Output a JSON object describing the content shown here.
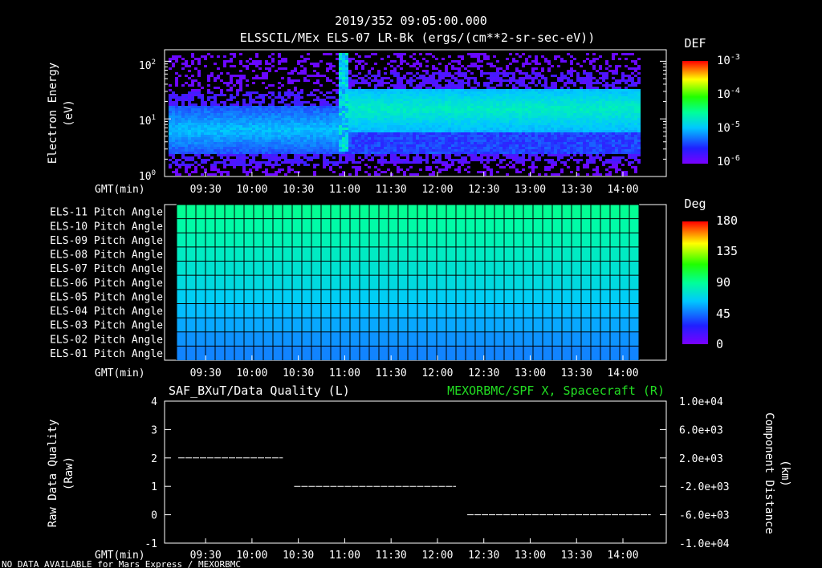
{
  "header": {
    "timestamp": "2019/352 09:05:00.000",
    "title": "ELSSCIL/MEx ELS-07 LR-Bk  (ergs/(cm**2-sr-sec-eV))"
  },
  "time_axis": {
    "label": "GMT(min)",
    "ticks": [
      "09:30",
      "10:00",
      "10:30",
      "11:00",
      "11:30",
      "12:00",
      "12:30",
      "13:00",
      "13:30",
      "14:00"
    ]
  },
  "footer": {
    "note": "NO DATA AVAILABLE for Mars Express / MEXORBMC"
  },
  "colors": {
    "background": "#000000",
    "foreground": "#ffffff",
    "right_axis_title": "#22dd22"
  },
  "chart_data": [
    {
      "type": "heatmap",
      "title": "ELSSCIL/MEx ELS-07 LR-Bk  (ergs/(cm**2-sr-sec-eV))",
      "ylabel": "Electron Energy (eV)",
      "y_scale": "log",
      "y_ticks": [
        "10^0",
        "10^1",
        "10^2"
      ],
      "colorbar": {
        "title": "DEF",
        "scale": "log",
        "ticks": [
          "10^-3",
          "10^-4",
          "10^-5",
          "10^-6"
        ]
      },
      "description_values": {
        "before_1055": "low flux ~10^-6 to 10^-5 concentrated 3-15 eV",
        "after_1055": "enhanced flux ~10^-5 to 10^-4 at 5-30 eV, burst up to ~150 eV near 10:55"
      }
    },
    {
      "type": "heatmap",
      "colorbar": {
        "title": "Deg",
        "ticks": [
          "180",
          "135",
          "90",
          "45",
          "0"
        ]
      },
      "rows": [
        {
          "name": "ELS-11 Pitch Angle",
          "value": 110
        },
        {
          "name": "ELS-10 Pitch Angle",
          "value": 106
        },
        {
          "name": "ELS-09 Pitch Angle",
          "value": 102
        },
        {
          "name": "ELS-08 Pitch Angle",
          "value": 98
        },
        {
          "name": "ELS-07 Pitch Angle",
          "value": 94
        },
        {
          "name": "ELS-06 Pitch Angle",
          "value": 90
        },
        {
          "name": "ELS-05 Pitch Angle",
          "value": 84
        },
        {
          "name": "ELS-04 Pitch Angle",
          "value": 78
        },
        {
          "name": "ELS-03 Pitch Angle",
          "value": 72
        },
        {
          "name": "ELS-02 Pitch Angle",
          "value": 66
        },
        {
          "name": "ELS-01 Pitch Angle",
          "value": 62
        }
      ]
    },
    {
      "type": "line",
      "title_left": "SAF_BXuT/Data Quality (L)",
      "title_right": "MEXORBMC/SPF X, Spacecraft (R)",
      "ylabel": "Raw Data Quality (Raw)",
      "ylabel_right": "Component Distance (km)",
      "ylim": [
        -1,
        4
      ],
      "y_ticks": [
        "4",
        "3",
        "2",
        "1",
        "0",
        "-1"
      ],
      "y_right_ticks": [
        "1.0e+04",
        "6.0e+03",
        "2.0e+03",
        "-2.0e+03",
        "-6.0e+03",
        "-1.0e+04"
      ],
      "series": [
        {
          "segments": [
            {
              "start": "09:05",
              "end": "10:20",
              "value": 2
            },
            {
              "start": "10:20",
              "end": "12:12",
              "value": 1
            },
            {
              "start": "12:12",
              "end": "14:18",
              "value": 0
            }
          ]
        }
      ]
    }
  ]
}
